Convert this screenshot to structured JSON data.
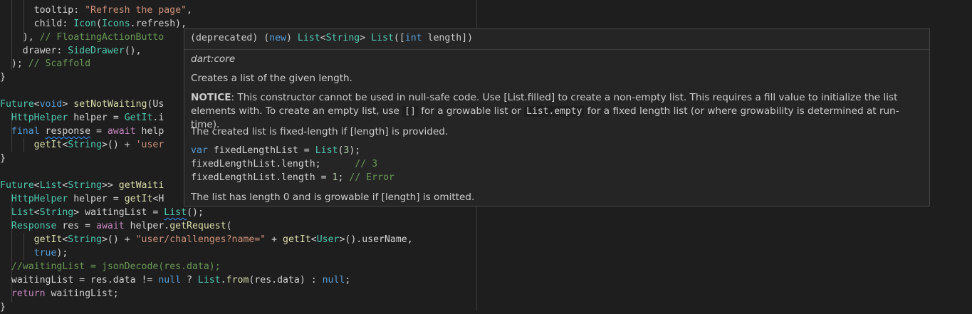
{
  "code": {
    "l01": {
      "a": "      tooltip: ",
      "b": "\"Refresh the page\"",
      "c": ","
    },
    "l02": {
      "a": "      child: ",
      "b": "Icon",
      "c": "(",
      "d": "Icons",
      "e": ".refresh),"
    },
    "l03": {
      "a": "    ), ",
      "b": "// FloatingActionButto"
    },
    "l04": {
      "a": "    drawer: ",
      "b": "SideDrawer",
      "c": "(),"
    },
    "l05": {
      "a": "  ); ",
      "b": "// Scaffold"
    },
    "l06": {
      "a": "}"
    },
    "l08": {
      "a": "Future",
      "b": "<",
      "c": "void",
      "d": "> ",
      "e": "setNotWaiting",
      "f": "(Us"
    },
    "l09": {
      "a": "  ",
      "b": "HttpHelper",
      "c": " helper = ",
      "d": "GetIt",
      ".e": "",
      "e": ".i"
    },
    "l10": {
      "a": "  ",
      "b": "final",
      "c": " ",
      "d": "response",
      "e": " = ",
      "f": "await",
      "g": " help"
    },
    "l11": {
      "a": "      ",
      "b": "getIt",
      "c": "<",
      "d": "String",
      "e": ">() + ",
      "f": "'user"
    },
    "l12": {
      "a": "}"
    },
    "l14": {
      "a": "Future",
      "b": "<",
      "c": "List",
      "d": "<",
      "e": "String",
      "f": ">> ",
      "g": "getWaiti"
    },
    "l15": {
      "a": "  ",
      "b": "HttpHelper",
      "c": " helper = ",
      "d": "getIt",
      "e": "<H"
    },
    "l16": {
      "a": "  ",
      "b": "List",
      "c": "<",
      "d": "String",
      "e": "> waitingList = ",
      "f": "List",
      "g": "();"
    },
    "l17": {
      "a": "  ",
      "b": "Response",
      "c": " res = ",
      "d": "await",
      "e": " helper.",
      "f": "getRequest",
      "g": "("
    },
    "l18": {
      "a": "      ",
      "b": "getIt",
      "c": "<",
      "d": "String",
      "e": ">() + ",
      "f": "\"user/challenges?name=\"",
      "g": " + ",
      "h": "getIt",
      "i": "<",
      "j": "User",
      "k": ">().userName,"
    },
    "l19": {
      "a": "      ",
      "b": "true",
      "c": ");"
    },
    "l20": {
      "a": "  ",
      "b": "//waitingList = jsonDecode(res.data);"
    },
    "l21": {
      "a": "  waitingList = res.data != ",
      "b": "null",
      "c": " ? ",
      "d": "List",
      ".e": "",
      "e": ".",
      "f": "from",
      "g": "(res.data) : ",
      "h": "null",
      "i": ";"
    },
    "l22": {
      "a": "  ",
      "b": "return",
      "c": " waitingList;"
    },
    "l23": {
      "a": "}"
    }
  },
  "hover": {
    "signature": {
      "p1": "(deprecated) (",
      "p2": "new",
      "p3": ") ",
      "p4": "List",
      "p5": "<",
      "p6": "String",
      "p7": "> ",
      "p8": "List",
      "p9": "([",
      "p10": "int",
      "p11": " length])"
    },
    "library": "dart:core",
    "desc1": "Creates a list of the given length.",
    "notice_label": "NOTICE",
    "notice_a": ": This constructor cannot be used in null-safe code. Use [List.filled] to create a non-empty list. This requires a fill value to initialize the list elements with. To create an empty list, use ",
    "notice_code1": "[]",
    "notice_b": " for a growable list or ",
    "notice_code2": "List.empty",
    "notice_c": " for a fixed length list (or where growability is determined at run-time).",
    "desc2": "The created list is fixed-length if [length] is provided.",
    "ex1": {
      "a": "var",
      "b": " fixedLengthList = ",
      "c": "List",
      "d": "(",
      "e": "3",
      "f": ");"
    },
    "ex2": {
      "a": "fixedLengthList.length;      ",
      "b": "// 3"
    },
    "ex3": {
      "a": "fixedLengthList.length = ",
      "b": "1",
      "c": "; ",
      "d": "// Error"
    },
    "desc3": "The list has length 0 and is growable if [length] is omitted."
  },
  "colors": {
    "background": "#1e1e1e",
    "hover_bg": "#252526",
    "keyword": "#569cd6",
    "control": "#c586c0",
    "type": "#4ec9b0",
    "function": "#dcdcaa",
    "string": "#ce9178",
    "comment": "#6a9955"
  }
}
